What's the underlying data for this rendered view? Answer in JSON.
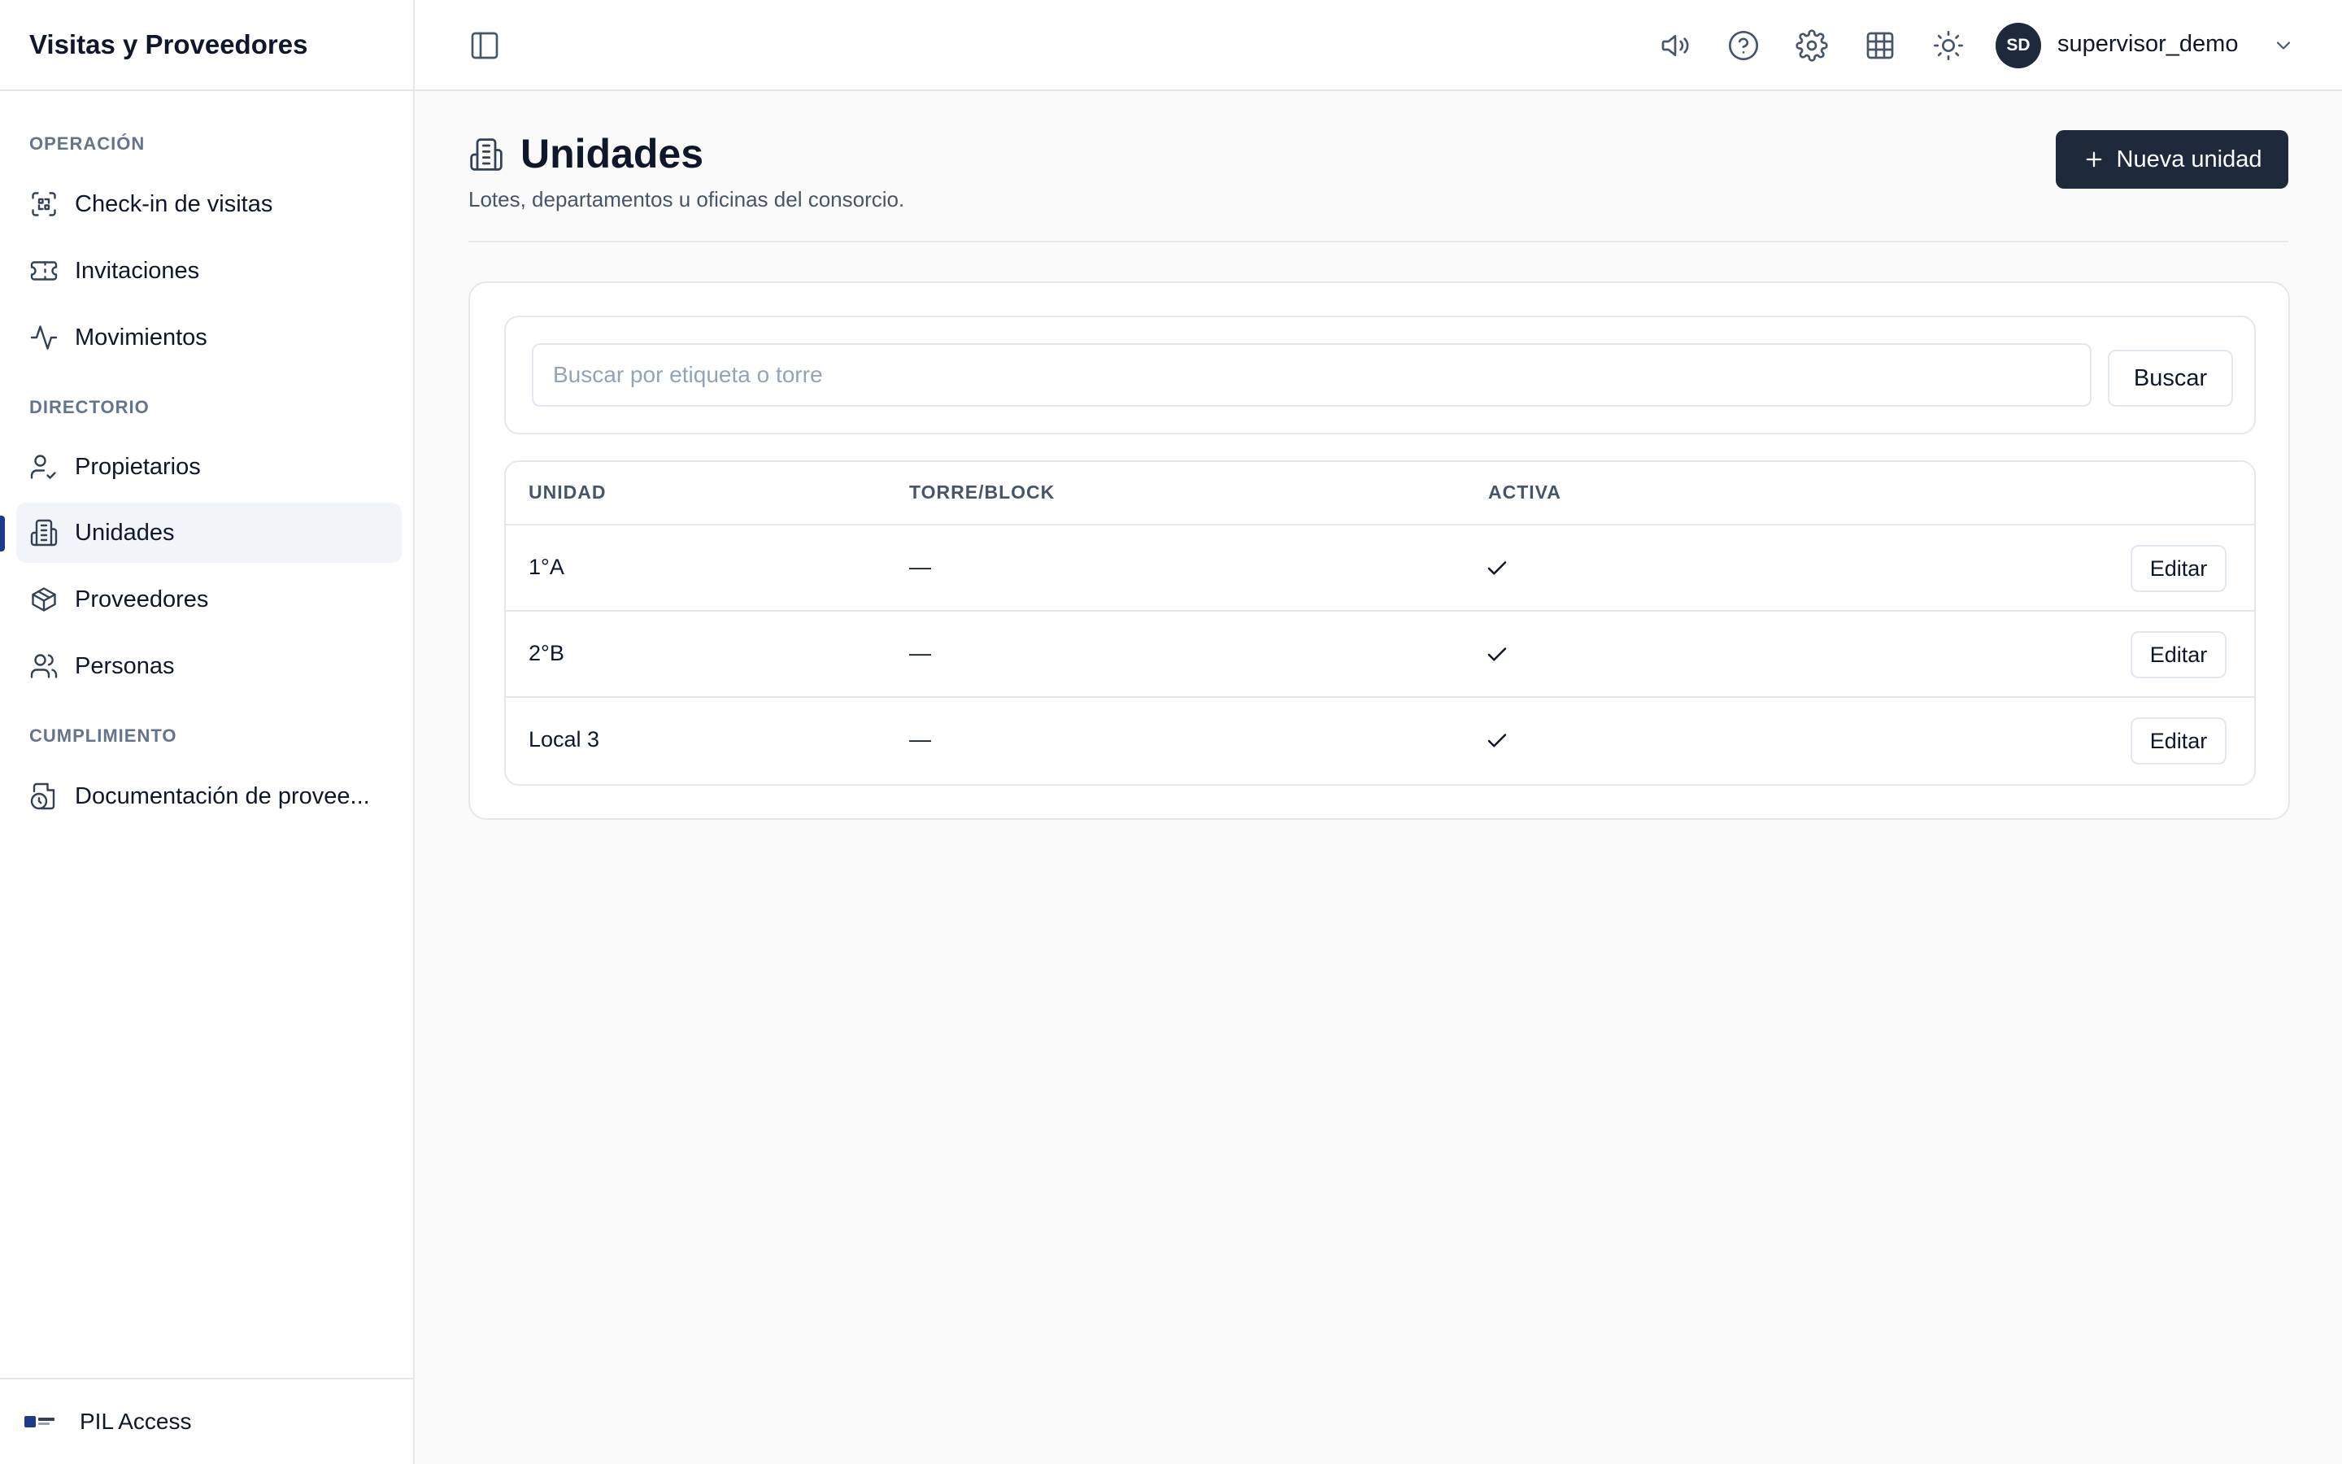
{
  "app": {
    "title": "Visitas y Proveedores"
  },
  "sidebar": {
    "sections": [
      {
        "label": "OPERACIÓN"
      },
      {
        "label": "DIRECTORIO"
      },
      {
        "label": "CUMPLIMIENTO"
      }
    ],
    "items": [
      {
        "label": "Check-in de visitas",
        "icon": "scan-icon"
      },
      {
        "label": "Invitaciones",
        "icon": "ticket-icon"
      },
      {
        "label": "Movimientos",
        "icon": "activity-icon"
      },
      {
        "label": "Propietarios",
        "icon": "user-check-icon"
      },
      {
        "label": "Unidades",
        "icon": "building-icon",
        "active": true
      },
      {
        "label": "Proveedores",
        "icon": "package-icon"
      },
      {
        "label": "Personas",
        "icon": "users-icon"
      },
      {
        "label": "Documentación de provee...",
        "icon": "file-clock-icon"
      }
    ],
    "footer": {
      "label": "PIL Access"
    }
  },
  "topbar": {
    "icons": [
      "sidebar-toggle-icon",
      "megaphone-icon",
      "help-icon",
      "settings-icon",
      "grid-icon",
      "sun-icon"
    ],
    "user": {
      "initials": "SD",
      "name": "supervisor_demo"
    }
  },
  "page": {
    "title": "Unidades",
    "subtitle": "Lotes, departamentos u oficinas del consorcio.",
    "new_button": "Nueva unidad"
  },
  "search": {
    "placeholder": "Buscar por etiqueta o torre",
    "value": "",
    "button": "Buscar"
  },
  "table": {
    "columns": [
      "UNIDAD",
      "TORRE/BLOCK",
      "ACTIVA"
    ],
    "rows": [
      {
        "unidad": "1°A",
        "torre": "—",
        "activa": true,
        "action": "Editar"
      },
      {
        "unidad": "2°B",
        "torre": "—",
        "activa": true,
        "action": "Editar"
      },
      {
        "unidad": "Local 3",
        "torre": "—",
        "activa": true,
        "action": "Editar"
      }
    ]
  },
  "colors": {
    "primary": "#1e293b",
    "active_indicator": "#1e3a8a",
    "muted_text": "#64748b",
    "border": "#e5e7eb",
    "background": "#fafafa"
  }
}
